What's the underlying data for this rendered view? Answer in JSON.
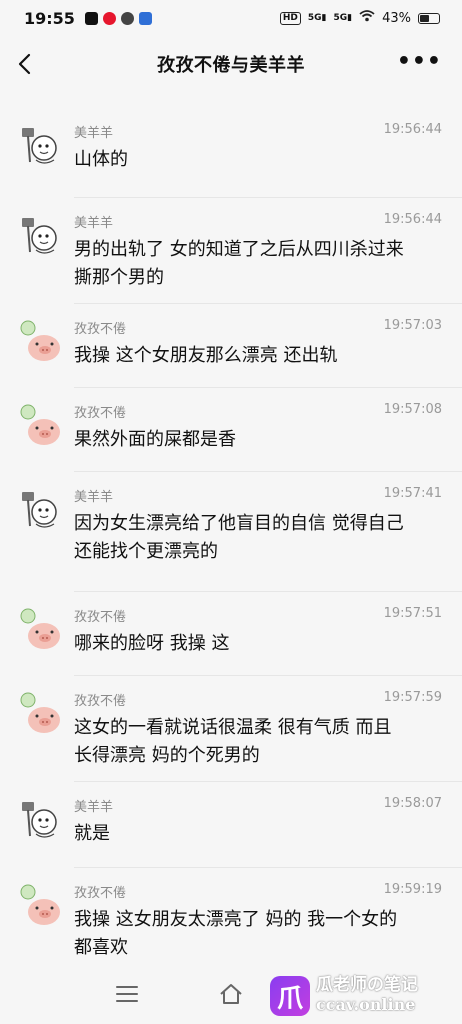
{
  "status": {
    "time": "19:55",
    "net1": "5G",
    "net2": "5G",
    "hd": "HD",
    "battery": "43%"
  },
  "header": {
    "title": "孜孜不倦与美羊羊",
    "more": "•••"
  },
  "messages": [
    {
      "sender": "美羊羊",
      "time": "19:56:44",
      "text": [
        "山体的"
      ],
      "avatar": "sheep"
    },
    {
      "sender": "美羊羊",
      "time": "19:56:44",
      "text": [
        "男的出轨了  女的知道了之后从四川杀过来",
        "撕那个男的"
      ],
      "avatar": "sheep"
    },
    {
      "sender": "孜孜不倦",
      "time": "19:57:03",
      "text": [
        "我操  这个女朋友那么漂亮  还出轨"
      ],
      "avatar": "pig"
    },
    {
      "sender": "孜孜不倦",
      "time": "19:57:08",
      "text": [
        "果然外面的屎都是香"
      ],
      "avatar": "pig"
    },
    {
      "sender": "美羊羊",
      "time": "19:57:41",
      "text": [
        "因为女生漂亮给了他盲目的自信  觉得自己",
        "还能找个更漂亮的"
      ],
      "avatar": "sheep"
    },
    {
      "sender": "孜孜不倦",
      "time": "19:57:51",
      "text": [
        "哪来的脸呀  我操  这"
      ],
      "avatar": "pig"
    },
    {
      "sender": "孜孜不倦",
      "time": "19:57:59",
      "text": [
        "这女的一看就说话很温柔  很有气质  而且",
        "长得漂亮  妈的个死男的"
      ],
      "avatar": "pig"
    },
    {
      "sender": "美羊羊",
      "time": "19:58:07",
      "text": [
        "就是"
      ],
      "avatar": "sheep"
    },
    {
      "sender": "孜孜不倦",
      "time": "19:59:19",
      "text": [
        "我操  这女朋友太漂亮了  妈的  我一个女的",
        "都喜欢"
      ],
      "avatar": "pig"
    }
  ],
  "watermark": {
    "line1": "瓜老师の笔记",
    "line2": "ccav.online",
    "logo": "爪"
  },
  "colors": {
    "background": "#f6f6f6",
    "meta_text": "#8a8a8a",
    "pig_pink": "#f4c1b8",
    "watermark_purple": "#9b3fe8"
  },
  "icons": [
    "back-arrow-icon",
    "more-dots-icon",
    "menu-icon",
    "home-icon"
  ]
}
